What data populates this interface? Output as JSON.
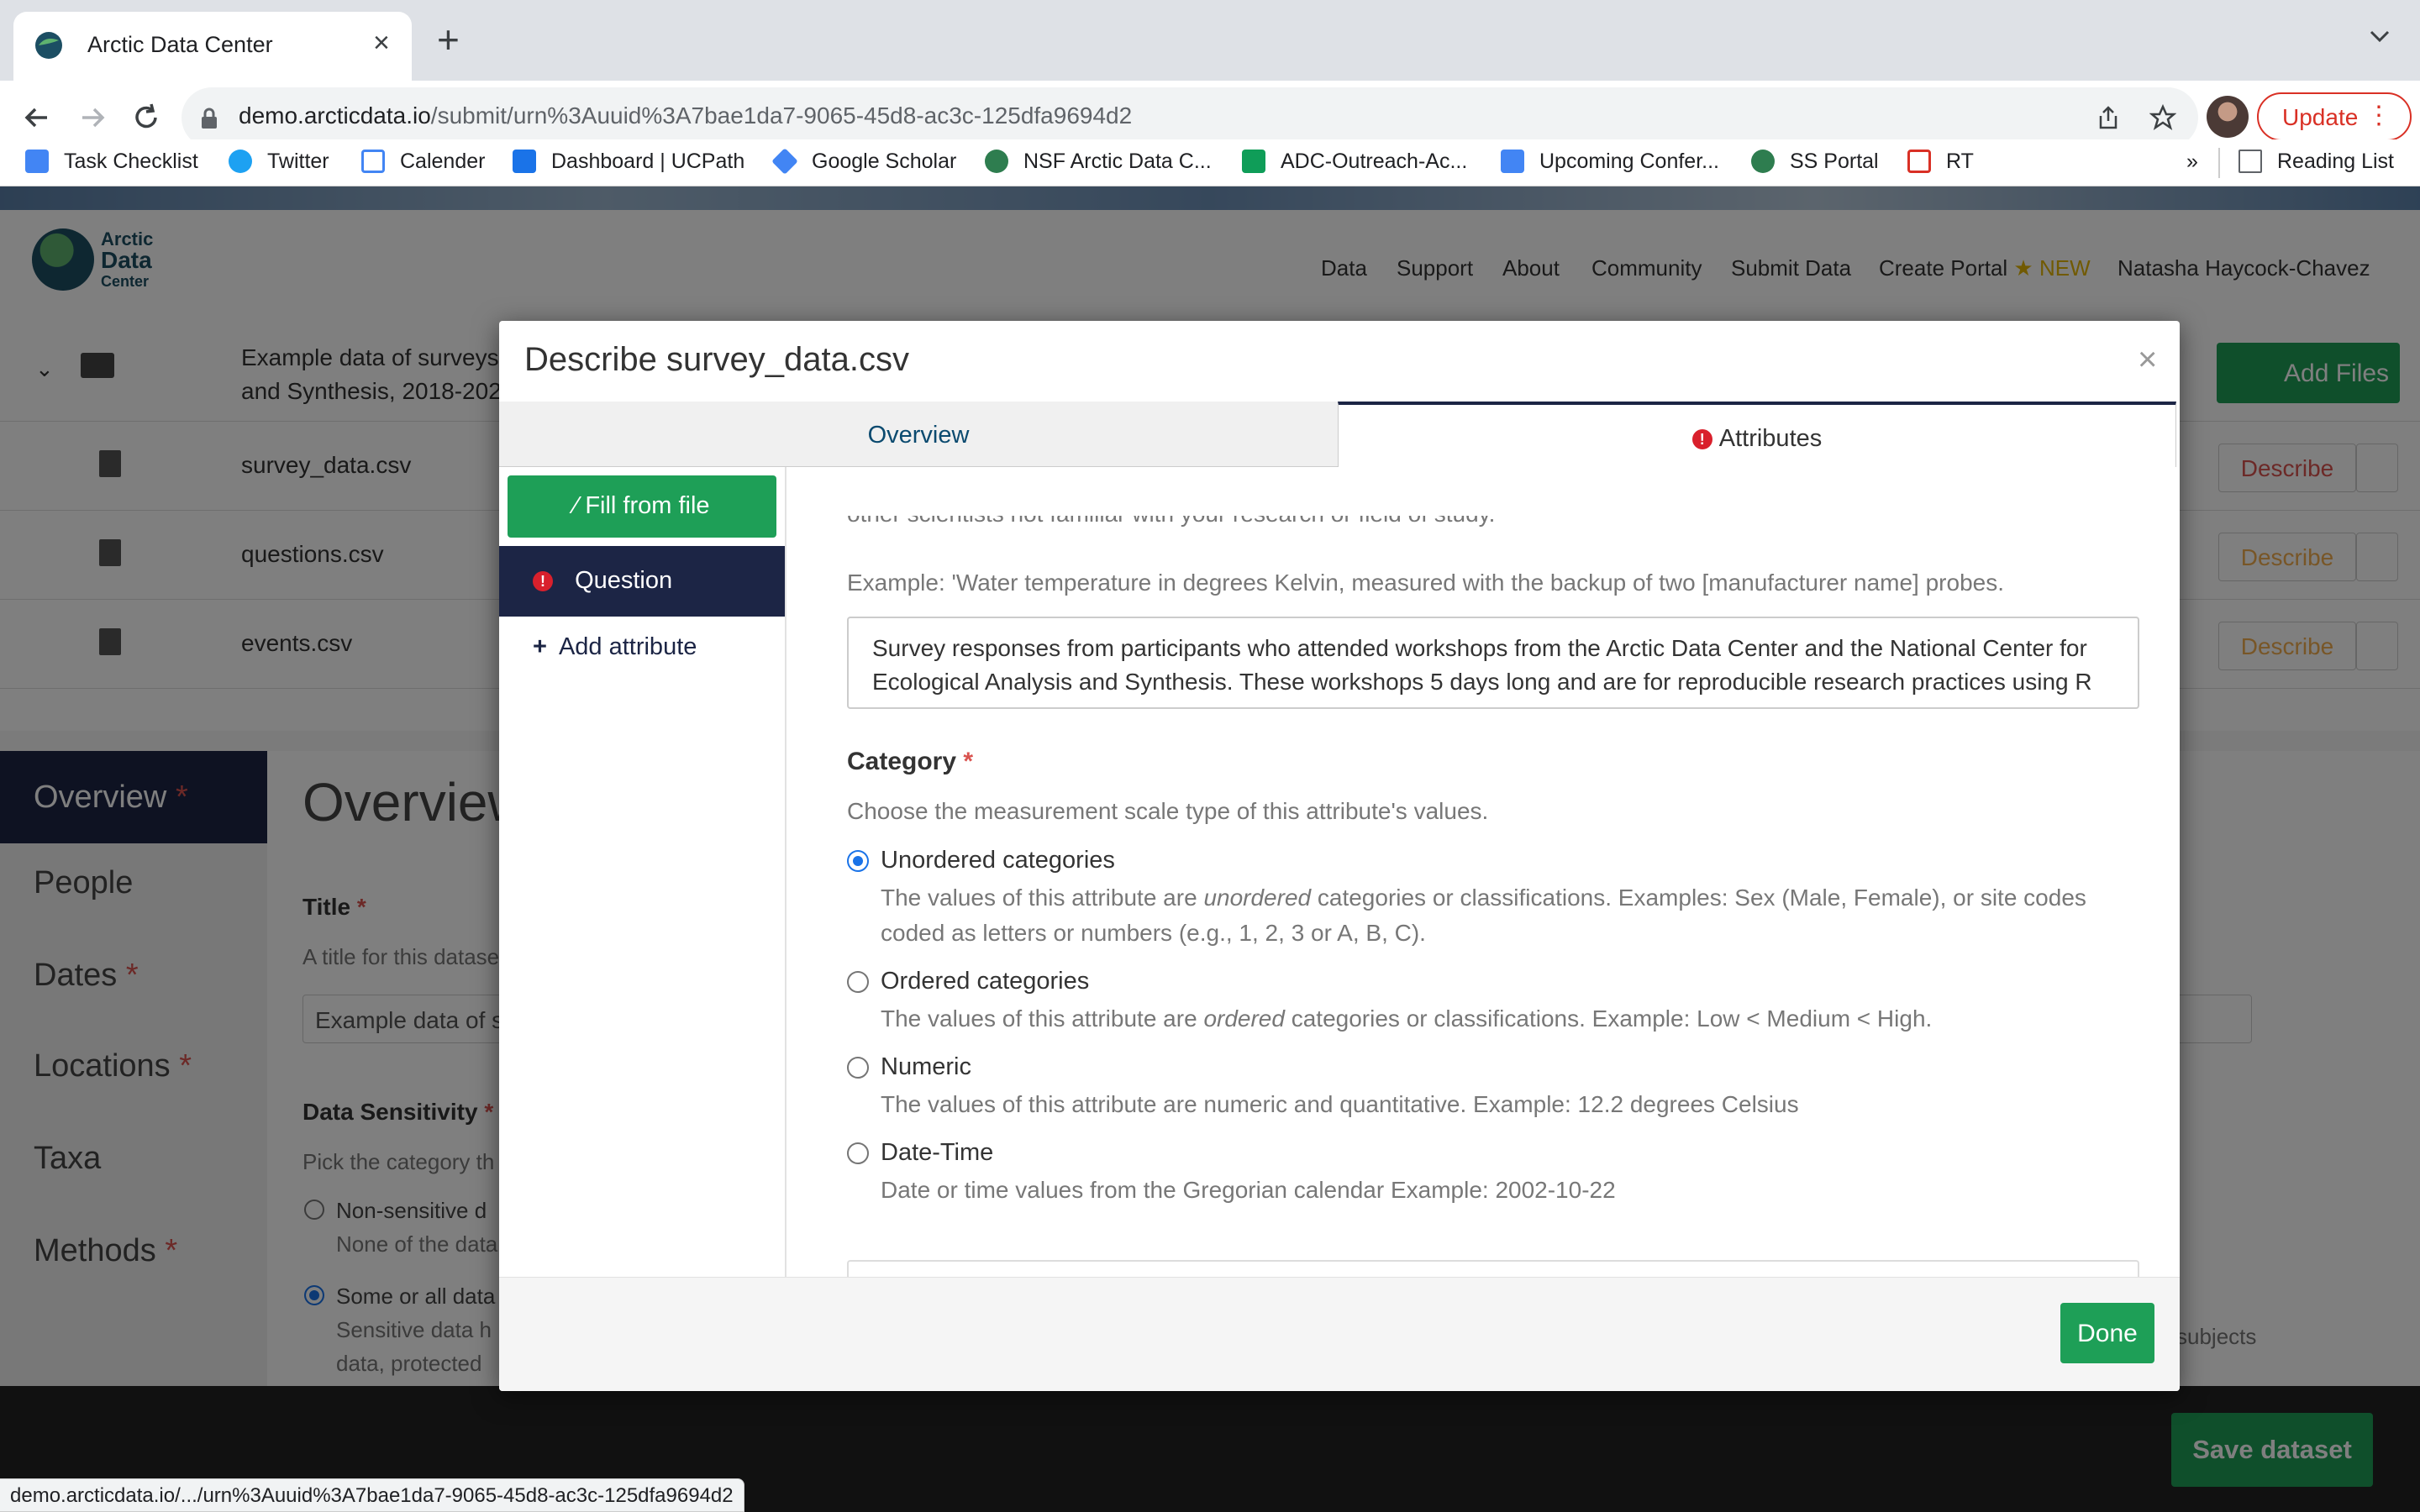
{
  "browser": {
    "tab_title": "Arctic Data Center",
    "url_host": "demo.arcticdata.io",
    "url_path": "/submit/urn%3Auuid%3A7bae1da7-9065-45d8-ac3c-125dfa9694d2",
    "update_label": "Update",
    "bookmarks": [
      {
        "label": "Task Checklist",
        "icon": "docs-icon",
        "color": "#4285f4"
      },
      {
        "label": "Twitter",
        "icon": "twitter-icon",
        "color": "#1da1f2"
      },
      {
        "label": "Calender",
        "icon": "calendar-icon",
        "color": "#4285f4"
      },
      {
        "label": "Dashboard | UCPath",
        "icon": "ucpath-icon",
        "color": "#1a73e8"
      },
      {
        "label": "Google Scholar",
        "icon": "scholar-icon",
        "color": "#4285f4"
      },
      {
        "label": "NSF Arctic Data C...",
        "icon": "adc-icon",
        "color": "#2e7d4f"
      },
      {
        "label": "ADC-Outreach-Ac...",
        "icon": "sheets-icon",
        "color": "#0f9d58"
      },
      {
        "label": "Upcoming Confer...",
        "icon": "docs-icon",
        "color": "#4285f4"
      },
      {
        "label": "SS Portal",
        "icon": "adc-icon",
        "color": "#2e7d4f"
      },
      {
        "label": "RT",
        "icon": "rt-icon",
        "color": "#d93025"
      }
    ],
    "bookmarks_overflow": "»",
    "reading_list": "Reading List",
    "status_url": "demo.arcticdata.io/.../urn%3Auuid%3A7bae1da7-9065-45d8-ac3c-125dfa9694d2"
  },
  "site": {
    "logo_lines": [
      "Arctic",
      "Data",
      "Center"
    ],
    "nav": [
      "Data",
      "Support",
      "About",
      "Community",
      "Submit Data",
      "Create Portal"
    ],
    "new_badge": "★ NEW",
    "user": "Natasha Haycock-Chavez",
    "dataset_title": "Example data of surveys and Synthesis, 2018-202",
    "add_files": "Add Files",
    "files": [
      "survey_data.csv",
      "questions.csv",
      "events.csv"
    ],
    "describe_label": "Describe",
    "side_nav": [
      "Overview",
      "People",
      "Dates",
      "Locations",
      "Taxa",
      "Methods"
    ],
    "required_mark": "*",
    "overview_heading": "Overview",
    "title_label": "Title",
    "title_help": "A title for this datase",
    "title_value": "Example data of s",
    "sensitivity_label": "Data Sensitivity",
    "sensitivity_help": "Pick the category th",
    "sens_opt1": "Non-sensitive d",
    "sens_opt1_desc": "None of the data",
    "sens_opt2": "Some or all data",
    "sens_opt2_desc": "Sensitive data h",
    "sens_opt2_desc2": "data, protected",
    "subjects_fragment": "subjects",
    "save_label": "Save dataset"
  },
  "modal": {
    "title": "Describe survey_data.csv",
    "close": "×",
    "tab_overview": "Overview",
    "tab_attributes": "Attributes",
    "fill_from_file": "Fill from file",
    "current_attribute": "Question",
    "add_attribute": "Add attribute",
    "cut_text": "other scientists not familiar with your research or field of study.",
    "example_text": "Example: 'Water temperature in degrees Kelvin, measured with the backup of two [manufacturer name] probes.",
    "definition_value": "Survey responses from participants who attended workshops from the Arctic Data Center and the National Center for Ecological Analysis and Synthesis. These workshops 5 days long and are for reproducible research practices using R",
    "category_label": "Category",
    "category_help": "Choose the measurement scale type of this attribute's values.",
    "options": [
      {
        "title": "Unordered categories",
        "desc_a": "The values of this attribute are ",
        "desc_em": "unordered",
        "desc_b": " categories or classifications. Examples: Sex (Male, Female), or site codes coded as letters or numbers (e.g., 1, 2, 3 or A, B, C).",
        "checked": true
      },
      {
        "title": "Ordered categories",
        "desc_a": "The values of this attribute are ",
        "desc_em": "ordered",
        "desc_b": " categories or classifications. Example: Low < Medium < High.",
        "checked": false
      },
      {
        "title": "Numeric",
        "desc_a": "The values of this attribute are numeric and quantitative. Example: 12.2 degrees Celsius",
        "desc_em": "",
        "desc_b": "",
        "checked": false
      },
      {
        "title": "Date-Time",
        "desc_a": "Date or time values from the Gregorian calendar Example: 2002-10-22",
        "desc_em": "",
        "desc_b": "",
        "checked": false
      }
    ],
    "done": "Done"
  },
  "colors": {
    "primary_green": "#1e9f57",
    "navy": "#1c2545",
    "error_red": "#d9202c"
  }
}
